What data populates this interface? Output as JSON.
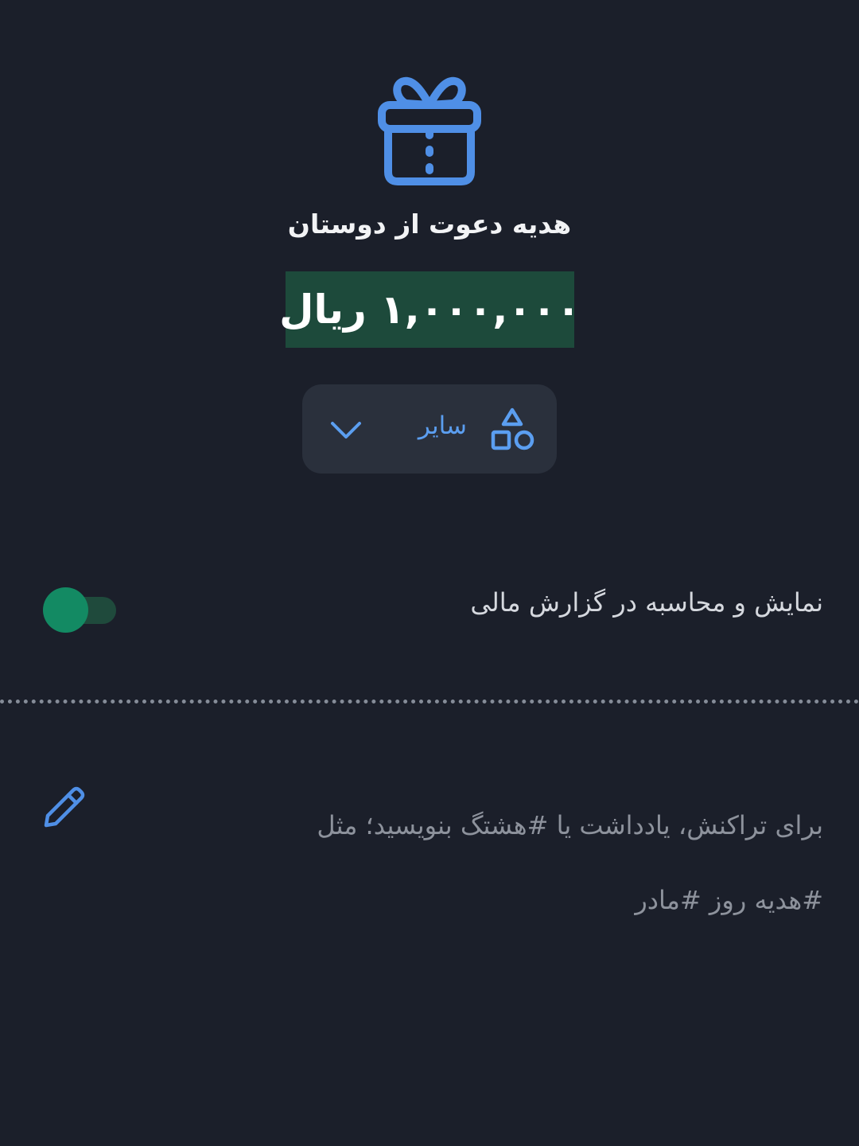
{
  "header": {
    "icon": "gift-icon",
    "title": "هدیه دعوت از دوستان",
    "amount": "۱,۰۰۰,۰۰۰ ریال"
  },
  "category": {
    "icon": "shapes-icon",
    "label": "سایر",
    "dropdown_icon": "chevron-down-icon"
  },
  "report_toggle": {
    "label": "نمایش و محاسبه در گزارش مالی",
    "enabled": true
  },
  "note": {
    "icon": "pencil-icon",
    "placeholder_line1": "برای تراکنش، یادداشت یا #هشتگ بنویسید؛ مثل",
    "placeholder_line2": "#هدیه روز #مادر"
  },
  "colors": {
    "background": "#1b1f2a",
    "accent_blue": "#5b9ef0",
    "accent_green": "#138a63",
    "amount_bg": "#1d4a3b"
  }
}
